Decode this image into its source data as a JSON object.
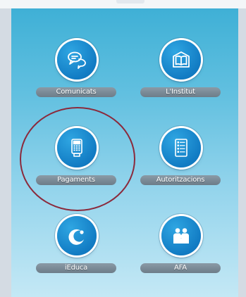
{
  "tiles": [
    {
      "label": "Comunicats",
      "icon": "chat-bubbles-icon"
    },
    {
      "label": "L'Institut",
      "icon": "open-book-icon"
    },
    {
      "label": "Pagaments",
      "icon": "payment-terminal-icon"
    },
    {
      "label": "Autoritzacions",
      "icon": "document-form-icon"
    },
    {
      "label": "iEduca",
      "icon": "ieduca-logo-icon"
    },
    {
      "label": "AFA",
      "icon": "family-icon"
    }
  ],
  "colors": {
    "panel_top": "#3fb0d6",
    "panel_bottom": "#c4e8f5",
    "icon_circle": "#127cc4",
    "label_pill": "#7a8a96",
    "highlight_ring": "#8b2a3c"
  }
}
